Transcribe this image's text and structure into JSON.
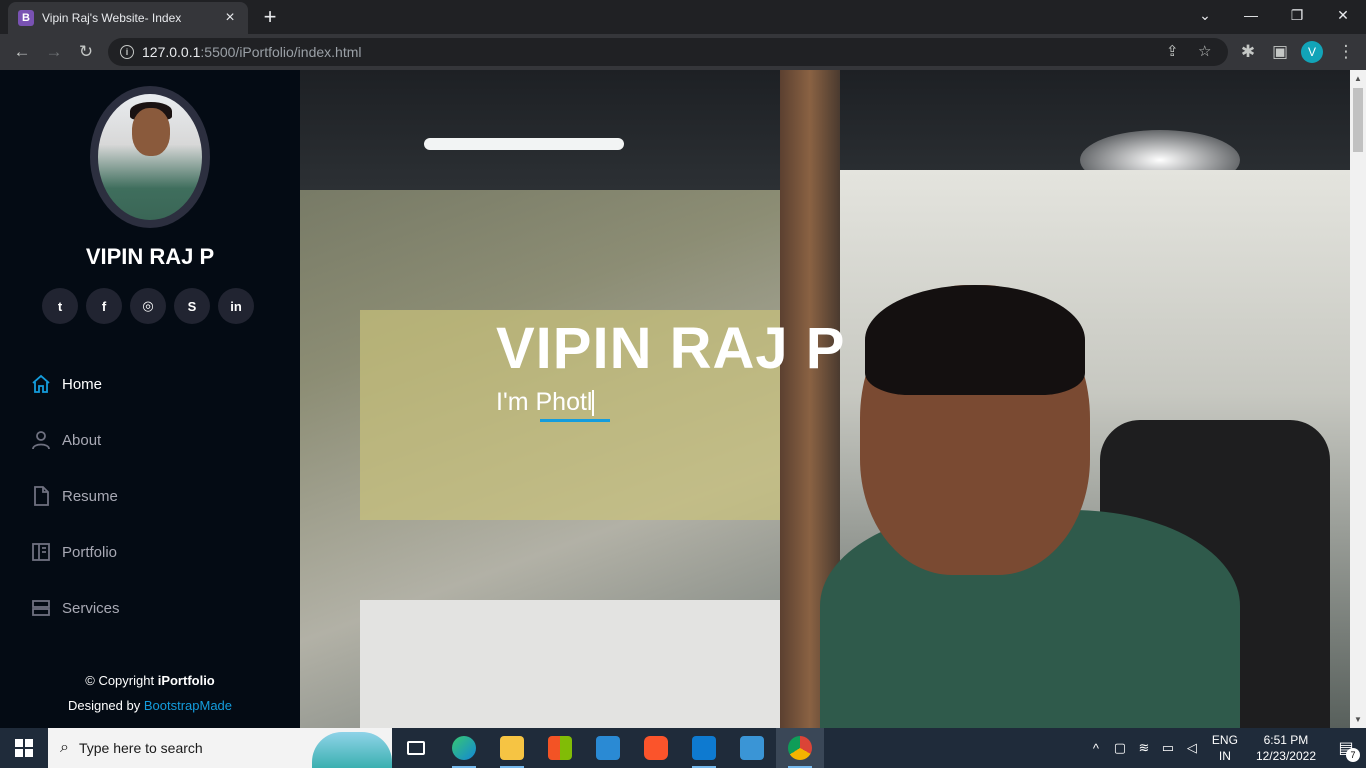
{
  "browser": {
    "tab_title": "Vipin Raj's Website- Index",
    "tab_favicon": "B",
    "url_host": "127.0.0.1",
    "url_path": ":5500/iPortfolio/index.html",
    "profile_initial": "V"
  },
  "sidebar": {
    "name": "VIPIN RAJ P",
    "socials": [
      {
        "icon": "twitter-icon",
        "glyph": "t"
      },
      {
        "icon": "facebook-icon",
        "glyph": "f"
      },
      {
        "icon": "instagram-icon",
        "glyph": "◎"
      },
      {
        "icon": "skype-icon",
        "glyph": "S"
      },
      {
        "icon": "linkedin-icon",
        "glyph": "in"
      }
    ],
    "nav": [
      {
        "label": "Home",
        "icon": "home-icon",
        "active": true
      },
      {
        "label": "About",
        "icon": "person-icon",
        "active": false
      },
      {
        "label": "Resume",
        "icon": "file-icon",
        "active": false
      },
      {
        "label": "Portfolio",
        "icon": "book-icon",
        "active": false
      },
      {
        "label": "Services",
        "icon": "server-icon",
        "active": false
      }
    ],
    "footer": {
      "copyright_prefix": "© Copyright ",
      "brand": "iPortfolio",
      "designed_by": "Designed by ",
      "designer": "BootstrapMade"
    }
  },
  "hero": {
    "title": "VIPIN RAJ P",
    "subtitle_prefix": "I'm ",
    "typed_text": "Photl"
  },
  "taskbar": {
    "search_placeholder": "Type here to search",
    "lang_top": "ENG",
    "lang_bottom": "IN",
    "time": "6:51 PM",
    "date": "12/23/2022",
    "notifications": "7"
  },
  "colors": {
    "accent": "#149ddd",
    "sidebar_bg": "#040b14",
    "social_bg": "#212431"
  }
}
